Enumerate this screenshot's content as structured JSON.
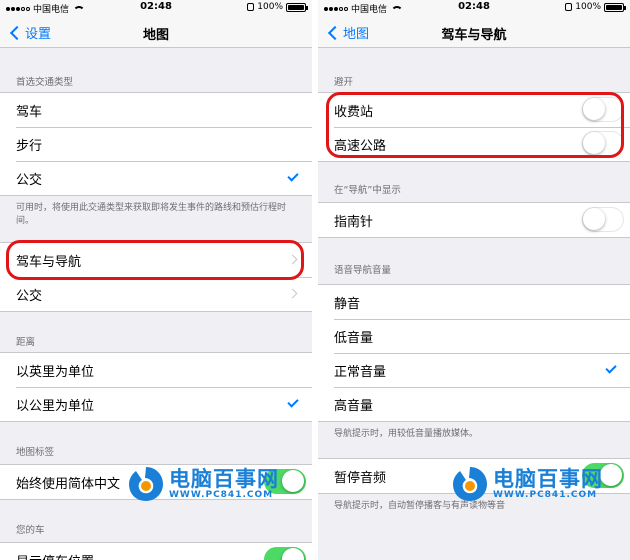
{
  "status": {
    "carrier": "中国电信",
    "time": "02:48",
    "battery": "100%",
    "battery_level": 1.0
  },
  "left": {
    "back_label": "设置",
    "title": "地图",
    "sec1": {
      "header": "首选交通类型",
      "items": [
        "驾车",
        "步行",
        "公交"
      ],
      "footer": "可用时，将使用此交通类型来获取即将发生事件的路线和预估行程时间。"
    },
    "sec2": {
      "items": [
        "驾车与导航",
        "公交"
      ]
    },
    "sec3": {
      "header": "距离",
      "items": [
        "以英里为单位",
        "以公里为单位"
      ]
    },
    "sec4": {
      "header": "地图标签",
      "items": [
        "始终使用简体中文"
      ]
    },
    "sec5": {
      "header": "您的车",
      "items": [
        "显示停车位置"
      ]
    }
  },
  "right": {
    "back_label": "地图",
    "title": "驾车与导航",
    "sec1": {
      "header": "避开",
      "items": [
        "收费站",
        "高速公路"
      ]
    },
    "sec2": {
      "header": "在“导航”中显示",
      "items": [
        "指南针"
      ]
    },
    "sec3": {
      "header": "语音导航音量",
      "items": [
        "静音",
        "低音量",
        "正常音量",
        "高音量"
      ],
      "footer": "导航提示时，用较低音量播放媒体。"
    },
    "sec4": {
      "items": [
        "暂停音频"
      ],
      "footer": "导航提示时，自动暂停播客与有声读物等音"
    }
  },
  "watermark": {
    "title": "电脑百事网",
    "url": "WWW.PC841.COM"
  },
  "colors": {
    "accent": "#007aff",
    "highlight": "#e01616",
    "toggle_on": "#4cd964",
    "watermark": "#1a7fd6"
  }
}
